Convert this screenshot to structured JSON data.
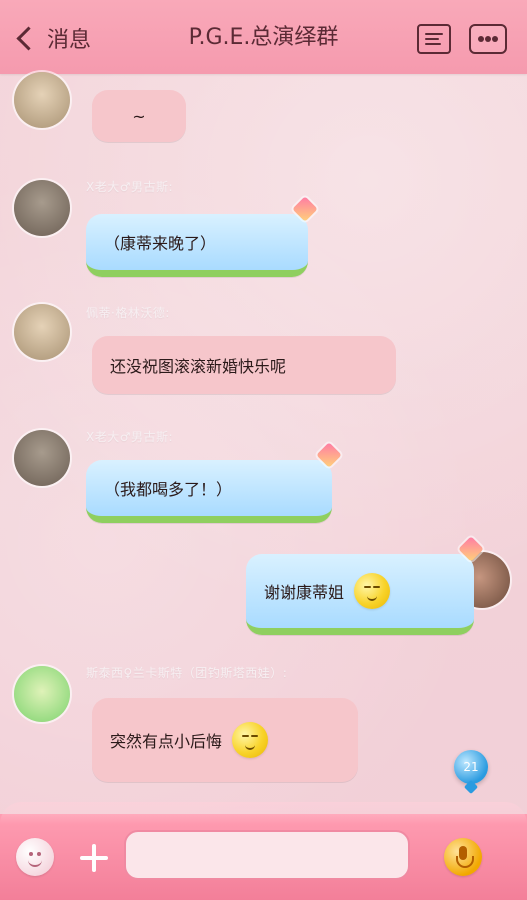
{
  "header": {
    "back_label": "消息",
    "title": "P.G.E.总演绎群"
  },
  "messages": [
    {
      "name": "",
      "text": "~",
      "bubble_style": "pink",
      "side": "left"
    },
    {
      "name": "X老大♂男古斯:",
      "text": "（康蒂来晚了）",
      "bubble_style": "blue",
      "side": "left"
    },
    {
      "name": "佩蒂·格林沃德:",
      "text": "还没祝图滚滚新婚快乐呢",
      "bubble_style": "pink",
      "side": "left"
    },
    {
      "name": "X老大♂男古斯:",
      "text": "（我都喝多了！）",
      "bubble_style": "blue",
      "side": "left"
    },
    {
      "name": "",
      "text": "谢谢康蒂姐",
      "bubble_style": "blue",
      "side": "right",
      "emoji": "slight-smile-emoji"
    },
    {
      "name": "斯泰西♀兰卡斯特（团钓斯塔西娃）:",
      "text": "突然有点小后悔",
      "bubble_style": "pink",
      "side": "left",
      "emoji": "blush-emoji"
    }
  ],
  "floating_badge": "21",
  "composer": {
    "placeholder": ""
  }
}
